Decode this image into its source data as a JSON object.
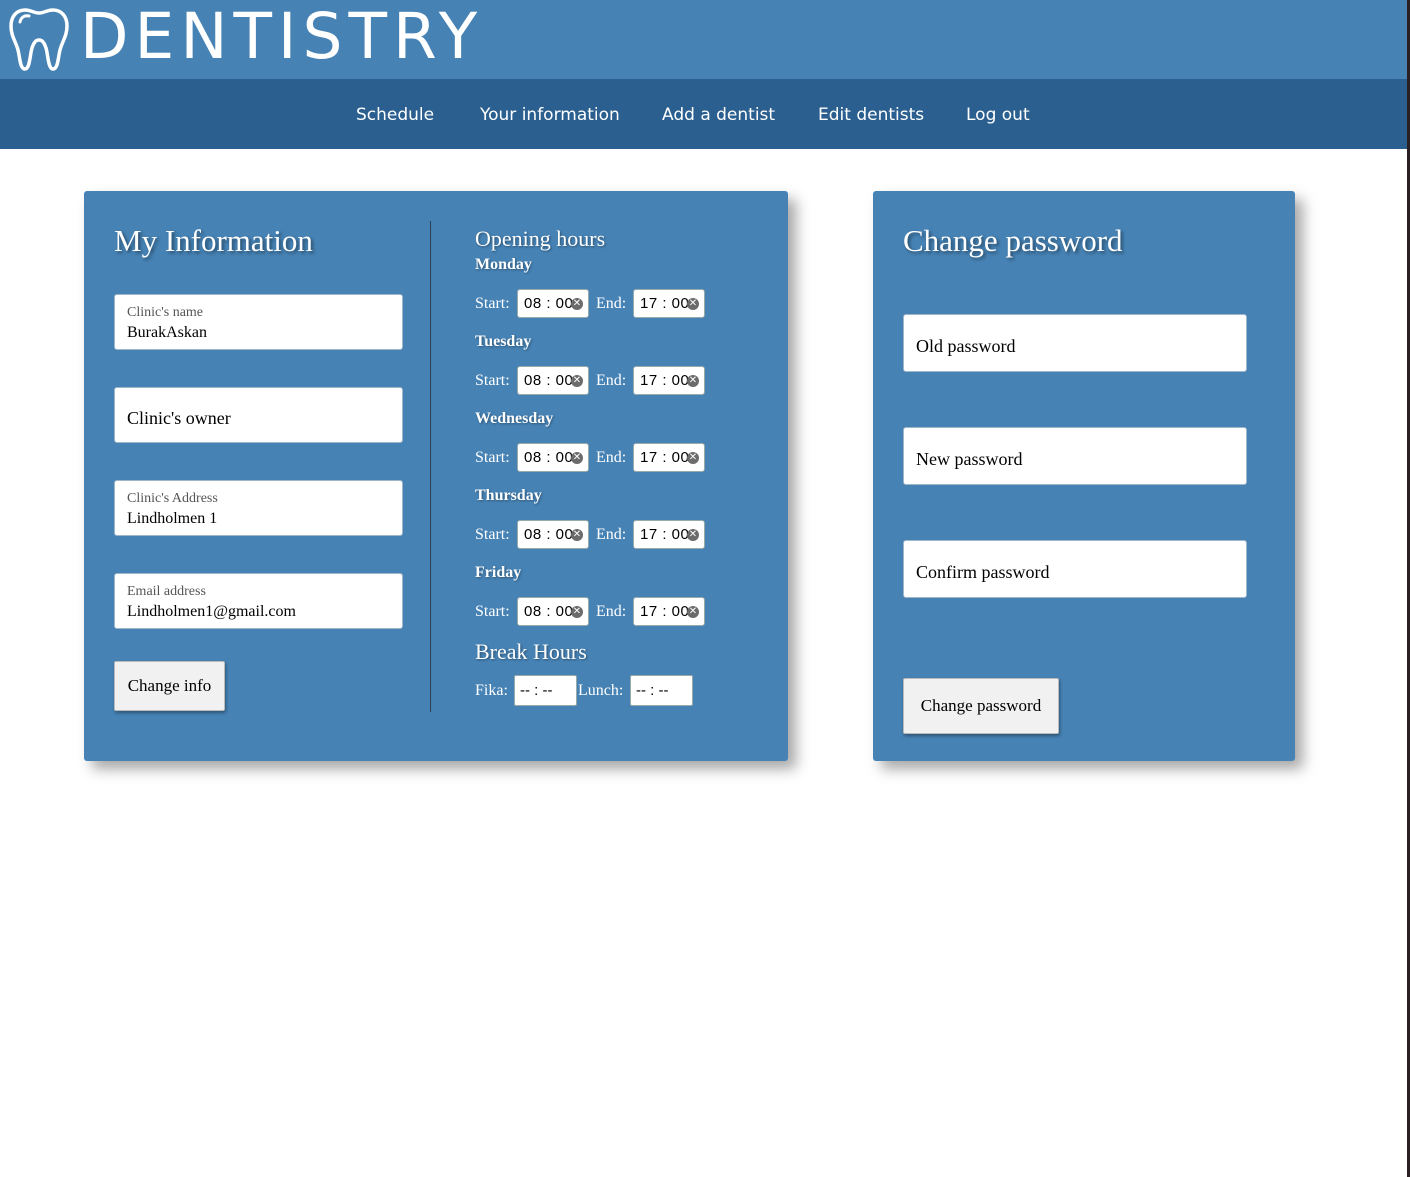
{
  "header": {
    "brand": "DENTISTRY",
    "logo_icon": "tooth-icon",
    "nav": [
      {
        "label": "Schedule"
      },
      {
        "label": "Your information"
      },
      {
        "label": "Add a dentist"
      },
      {
        "label": "Edit dentists"
      },
      {
        "label": "Log out"
      }
    ]
  },
  "info_card": {
    "title": "My Information",
    "fields": {
      "clinic_name": {
        "label": "Clinic's name",
        "value": "BurakAskan"
      },
      "clinic_owner": {
        "placeholder": "Clinic's owner"
      },
      "clinic_address": {
        "label": "Clinic's Address",
        "value": "Lindholmen 1"
      },
      "email": {
        "label": "Email address",
        "value": "Lindholmen1@gmail.com"
      }
    },
    "change_button": "Change info"
  },
  "opening_hours": {
    "title": "Opening hours",
    "start_label": "Start:",
    "end_label": "End:",
    "days": [
      {
        "day": "Monday",
        "start": "08 : 00",
        "end": "17 : 00"
      },
      {
        "day": "Tuesday",
        "start": "08 : 00",
        "end": "17 : 00"
      },
      {
        "day": "Wednesday",
        "start": "08 : 00",
        "end": "17 : 00"
      },
      {
        "day": "Thursday",
        "start": "08 : 00",
        "end": "17 : 00"
      },
      {
        "day": "Friday",
        "start": "08 : 00",
        "end": "17 : 00"
      }
    ],
    "clear_icon": "clear-icon"
  },
  "break_hours": {
    "title": "Break Hours",
    "fika_label": "Fika:",
    "fika_value": "-- : --",
    "lunch_label": "Lunch:",
    "lunch_value": "-- : --"
  },
  "password_card": {
    "title": "Change password",
    "old_placeholder": "Old password",
    "new_placeholder": "New password",
    "confirm_placeholder": "Confirm password",
    "button": "Change password"
  },
  "colors": {
    "brand_bar": "#4682b4",
    "nav_bar": "#2a5f8f",
    "card": "#4682b4"
  }
}
